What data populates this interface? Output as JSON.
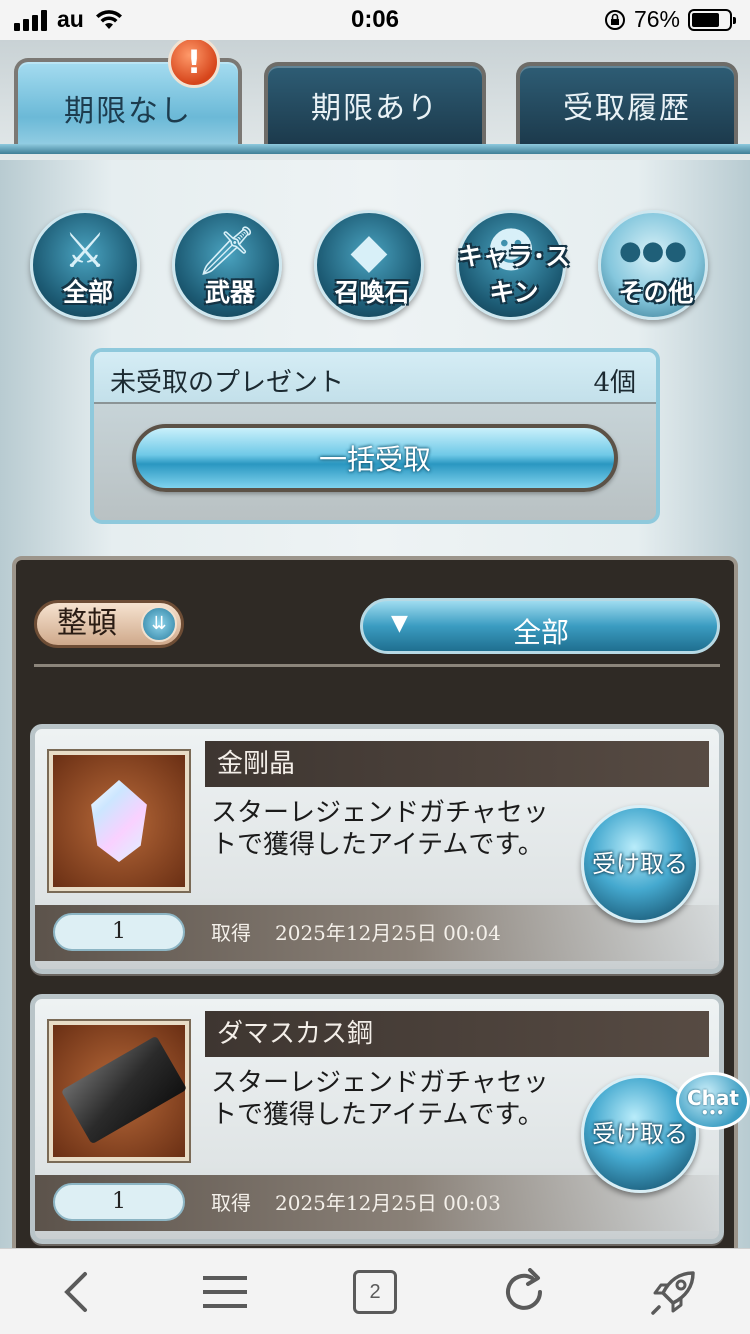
{
  "status_bar": {
    "carrier": "au",
    "time": "0:06",
    "battery_percent": "76%",
    "battery_level": 0.76
  },
  "tabs": [
    {
      "label": "期限なし",
      "active": true,
      "alert": "!"
    },
    {
      "label": "期限あり",
      "active": false
    },
    {
      "label": "受取履歴",
      "active": false
    }
  ],
  "categories": [
    {
      "label": "全部",
      "icon": "all-items-icon"
    },
    {
      "label": "武器",
      "icon": "sword-icon"
    },
    {
      "label": "召喚石",
      "icon": "crystal-icon"
    },
    {
      "label": "キャラ･スキン",
      "icon": "character-icon"
    },
    {
      "label": "その他",
      "icon": "more-dots-icon"
    }
  ],
  "present": {
    "title": "未受取のプレゼント",
    "count": "4個",
    "bulk_button": "一括受取"
  },
  "list": {
    "sort_label": "整頓",
    "filter_value": "全部"
  },
  "items": [
    {
      "name": "金剛晶",
      "description": "スターレジェンドガチャセットで獲得したアイテムです。",
      "receive_label": "受け取る",
      "quantity": "1",
      "acquired_label": "取得",
      "acquired_date": "2025年12月25日 00:04",
      "thumb_icon": "crystal-gem-icon"
    },
    {
      "name": "ダマスカス鋼",
      "description": "スターレジェンドガチャセットで獲得したアイテムです。",
      "receive_label": "受け取る",
      "quantity": "1",
      "acquired_label": "取得",
      "acquired_date": "2025年12月25日 00:03",
      "thumb_icon": "steel-ingot-icon"
    }
  ],
  "chat": {
    "label": "Chat",
    "dots": "•••"
  },
  "toolbar": {
    "tab_count": "2",
    "icons": [
      "back-icon",
      "menu-icon",
      "tabs-icon",
      "reload-icon",
      "rocket-icon"
    ]
  }
}
